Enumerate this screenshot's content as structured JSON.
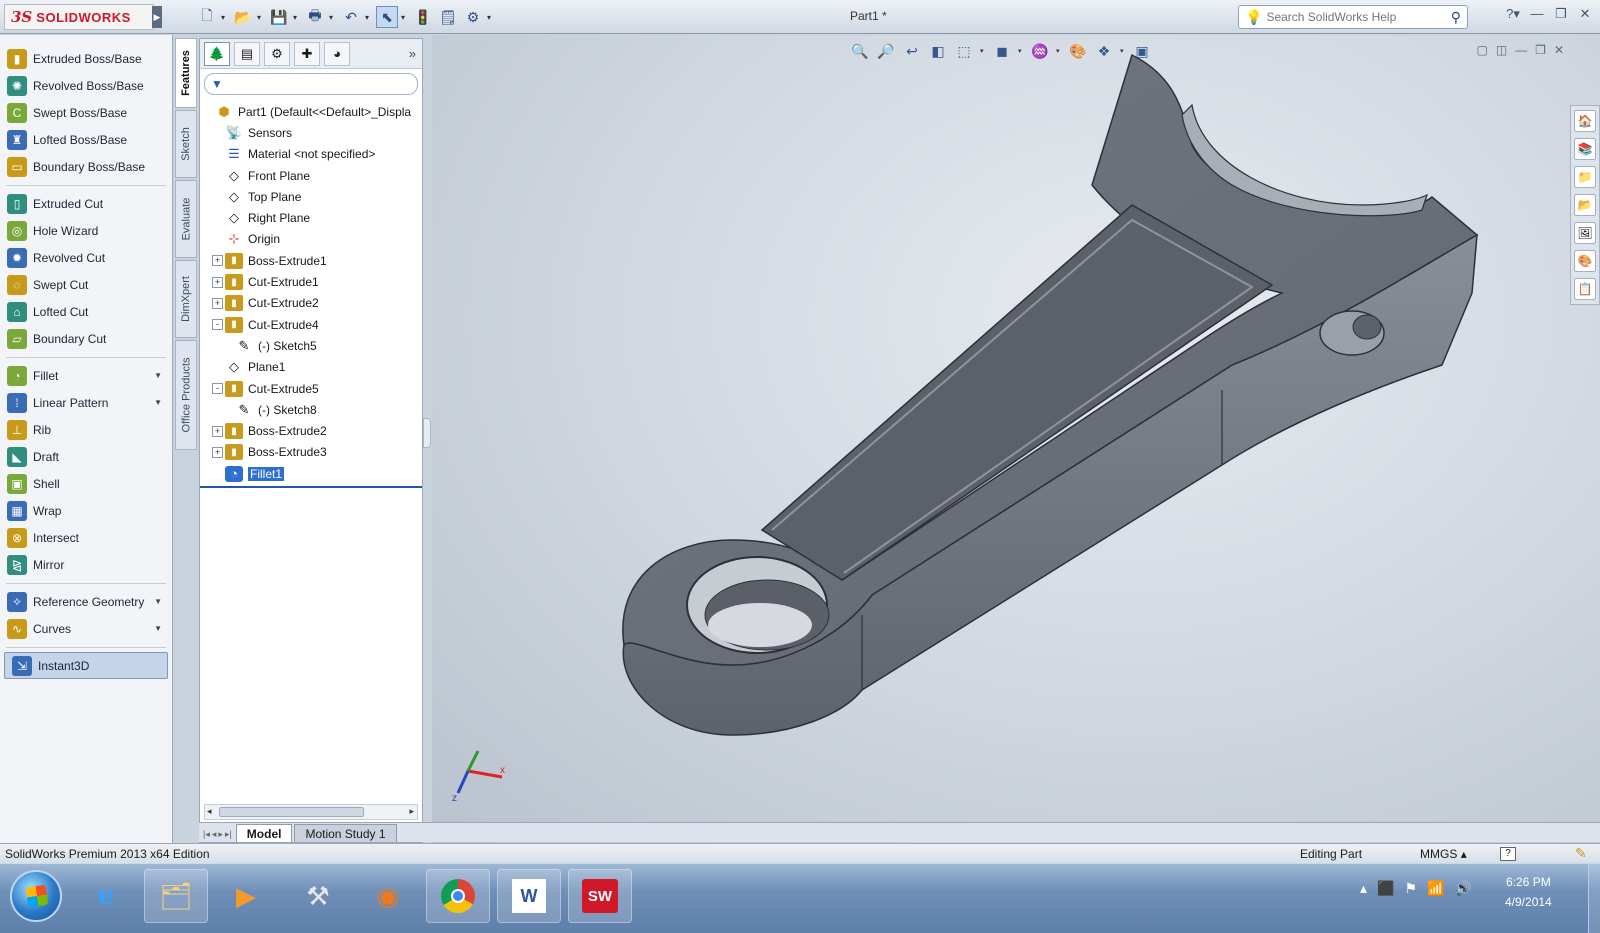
{
  "app": {
    "logo_mark": "3S",
    "logo_text": "SOLIDWORKS",
    "doc_title": "Part1 *",
    "help_search_placeholder": "Search SolidWorks Help"
  },
  "command_manager": {
    "groups": [
      [
        {
          "label": "Extruded Boss/Base",
          "icon": "extrude-boss-icon"
        },
        {
          "label": "Revolved Boss/Base",
          "icon": "revolve-boss-icon"
        },
        {
          "label": "Swept Boss/Base",
          "icon": "sweep-boss-icon"
        },
        {
          "label": "Lofted Boss/Base",
          "icon": "loft-boss-icon"
        },
        {
          "label": "Boundary Boss/Base",
          "icon": "boundary-boss-icon"
        }
      ],
      [
        {
          "label": "Extruded Cut",
          "icon": "extrude-cut-icon"
        },
        {
          "label": "Hole Wizard",
          "icon": "hole-wizard-icon"
        },
        {
          "label": "Revolved Cut",
          "icon": "revolve-cut-icon"
        },
        {
          "label": "Swept Cut",
          "icon": "sweep-cut-icon"
        },
        {
          "label": "Lofted Cut",
          "icon": "loft-cut-icon"
        },
        {
          "label": "Boundary Cut",
          "icon": "boundary-cut-icon"
        }
      ],
      [
        {
          "label": "Fillet",
          "icon": "fillet-icon",
          "dropdown": true
        },
        {
          "label": "Linear Pattern",
          "icon": "linear-pattern-icon",
          "dropdown": true
        },
        {
          "label": "Rib",
          "icon": "rib-icon"
        },
        {
          "label": "Draft",
          "icon": "draft-icon"
        },
        {
          "label": "Shell",
          "icon": "shell-icon"
        },
        {
          "label": "Wrap",
          "icon": "wrap-icon"
        },
        {
          "label": "Intersect",
          "icon": "intersect-icon"
        },
        {
          "label": "Mirror",
          "icon": "mirror-icon"
        }
      ],
      [
        {
          "label": "Reference Geometry",
          "icon": "reference-geometry-icon",
          "dropdown": true
        },
        {
          "label": "Curves",
          "icon": "curves-icon",
          "dropdown": true
        }
      ]
    ],
    "instant3d_label": "Instant3D"
  },
  "vertical_tabs": [
    "Features",
    "Sketch",
    "Evaluate",
    "DimXpert",
    "Office Products"
  ],
  "feature_tree": [
    {
      "label": "Part1  (Default<<Default>_Displa",
      "icon": "part-icon",
      "toggle": "",
      "indent": 0
    },
    {
      "label": "Sensors",
      "icon": "sensors-icon",
      "toggle": "",
      "indent": 1
    },
    {
      "label": "Material <not specified>",
      "icon": "material-icon",
      "toggle": "",
      "indent": 1
    },
    {
      "label": "Front Plane",
      "icon": "plane-icon",
      "toggle": "",
      "indent": 1
    },
    {
      "label": "Top Plane",
      "icon": "plane-icon",
      "toggle": "",
      "indent": 1
    },
    {
      "label": "Right Plane",
      "icon": "plane-icon",
      "toggle": "",
      "indent": 1
    },
    {
      "label": "Origin",
      "icon": "origin-icon",
      "toggle": "",
      "indent": 1
    },
    {
      "label": "Boss-Extrude1",
      "icon": "feature-icon",
      "toggle": "+",
      "indent": 1
    },
    {
      "label": "Cut-Extrude1",
      "icon": "feature-icon",
      "toggle": "+",
      "indent": 1
    },
    {
      "label": "Cut-Extrude2",
      "icon": "feature-icon",
      "toggle": "+",
      "indent": 1
    },
    {
      "label": "Cut-Extrude4",
      "icon": "feature-icon",
      "toggle": "-",
      "indent": 1
    },
    {
      "label": "(-) Sketch5",
      "icon": "sketch-icon",
      "toggle": "",
      "indent": 2
    },
    {
      "label": "Plane1",
      "icon": "plane-icon",
      "toggle": "",
      "indent": 1
    },
    {
      "label": "Cut-Extrude5",
      "icon": "feature-icon",
      "toggle": "-",
      "indent": 1
    },
    {
      "label": "(-) Sketch8",
      "icon": "sketch-icon",
      "toggle": "",
      "indent": 2
    },
    {
      "label": "Boss-Extrude2",
      "icon": "feature-icon",
      "toggle": "+",
      "indent": 1
    },
    {
      "label": "Boss-Extrude3",
      "icon": "feature-icon",
      "toggle": "+",
      "indent": 1
    },
    {
      "label": "Fillet1",
      "icon": "fillet-feature-icon",
      "toggle": "",
      "indent": 1,
      "selected": true
    }
  ],
  "bottom_tabs": {
    "model": "Model",
    "motion": "Motion Study 1"
  },
  "status": {
    "edition": "SolidWorks Premium 2013 x64 Edition",
    "editing": "Editing Part",
    "units": "MMGS",
    "units_drop": "▴",
    "help": "?"
  },
  "clock": {
    "time": "6:26 PM",
    "date": "4/9/2014"
  },
  "colors": {
    "accent": "#2f6fd1",
    "brand_red": "#d0182a",
    "model_face": "#6d717c"
  }
}
